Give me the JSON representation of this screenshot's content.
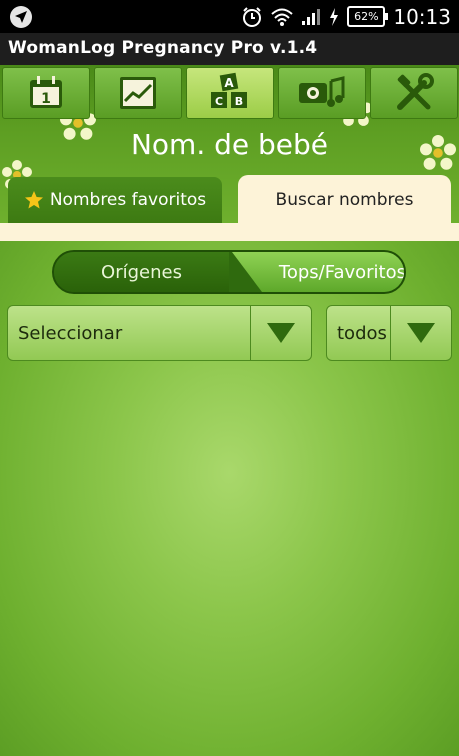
{
  "status_bar": {
    "battery": "62%",
    "time": "10:13"
  },
  "app_title": "WomanLog Pregnancy Pro v.1.4",
  "top_tabs": [
    {
      "icon": "calendar-icon"
    },
    {
      "icon": "chart-icon"
    },
    {
      "icon": "alphabet-blocks-icon"
    },
    {
      "icon": "camera-music-icon"
    },
    {
      "icon": "tools-icon"
    }
  ],
  "page_title": "Nom. de bebé",
  "sub_tabs": {
    "favorites": "Nombres favoritos",
    "search": "Buscar nombres"
  },
  "segmented": {
    "left": "Orígenes",
    "right": "Tops/Favoritos"
  },
  "dropdowns": {
    "select": "Seleccionar",
    "filter": "todos"
  },
  "colors": {
    "accent": "#6fb02e",
    "dark": "#2f6a0e",
    "cream": "#fdf3d8"
  }
}
